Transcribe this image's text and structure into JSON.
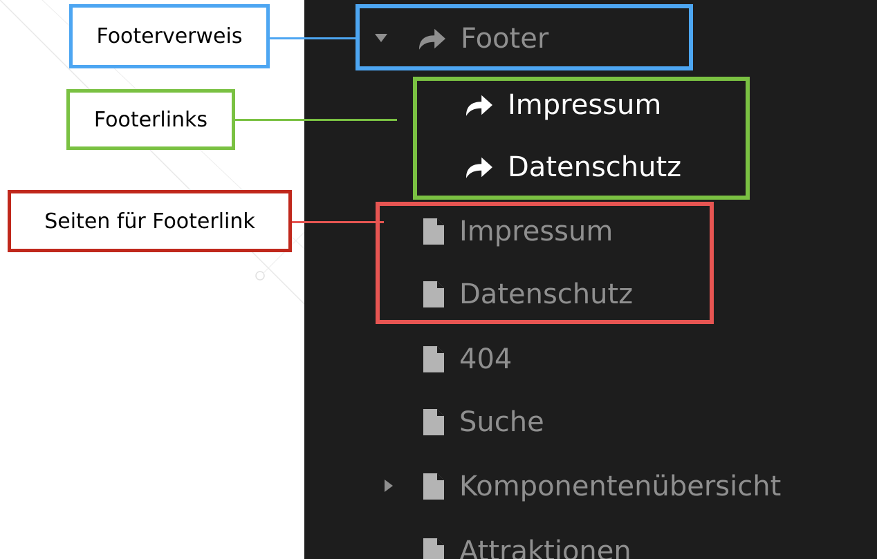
{
  "colors": {
    "panel_bg": "#1d1d1d",
    "dim_text": "#8f8f8f",
    "bright_text": "#ffffff",
    "blue": "#4da6f2",
    "green": "#7ac142",
    "red_border": "#c0281c",
    "red_frame": "#e75552"
  },
  "callouts": {
    "footerverweis": "Footerverweis",
    "footerlinks": "Footerlinks",
    "seiten": "Seiten für Footerlink"
  },
  "tree": {
    "footer": {
      "label": "Footer",
      "icon": "shortcut-icon",
      "toggle": "expanded"
    },
    "footer_link_1": {
      "label": "Impressum",
      "icon": "shortcut-icon"
    },
    "footer_link_2": {
      "label": "Datenschutz",
      "icon": "shortcut-icon"
    },
    "page_impressum": {
      "label": "Impressum",
      "icon": "page-icon"
    },
    "page_datenschutz": {
      "label": "Datenschutz",
      "icon": "page-icon"
    },
    "page_404": {
      "label": "404",
      "icon": "page-icon"
    },
    "page_suche": {
      "label": "Suche",
      "icon": "page-icon"
    },
    "page_komponenten": {
      "label": "Komponentenübersicht",
      "icon": "page-icon",
      "toggle": "collapsed"
    },
    "page_attraktionen": {
      "label": "Attraktionen",
      "icon": "page-icon"
    }
  }
}
